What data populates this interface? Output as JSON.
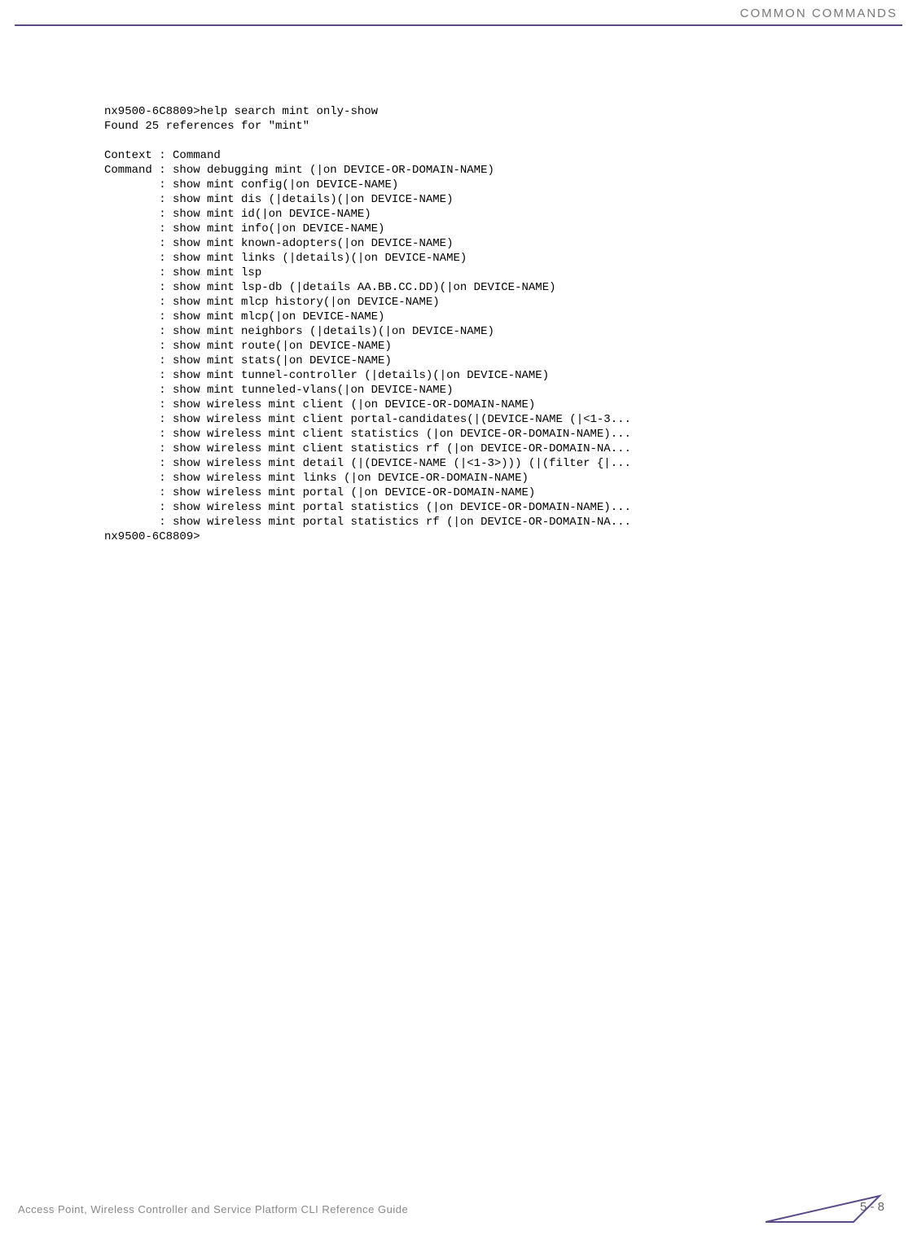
{
  "header": {
    "section_title": "COMMON COMMANDS"
  },
  "terminal": {
    "line01": "nx9500-6C8809>help search mint only-show",
    "line02": "Found 25 references for \"mint\"",
    "line03": "",
    "line04": "Context : Command",
    "line05": "Command : show debugging mint (|on DEVICE-OR-DOMAIN-NAME)",
    "line06": "        : show mint config(|on DEVICE-NAME)",
    "line07": "        : show mint dis (|details)(|on DEVICE-NAME)",
    "line08": "        : show mint id(|on DEVICE-NAME)",
    "line09": "        : show mint info(|on DEVICE-NAME)",
    "line10": "        : show mint known-adopters(|on DEVICE-NAME)",
    "line11": "        : show mint links (|details)(|on DEVICE-NAME)",
    "line12": "        : show mint lsp",
    "line13": "        : show mint lsp-db (|details AA.BB.CC.DD)(|on DEVICE-NAME)",
    "line14": "        : show mint mlcp history(|on DEVICE-NAME)",
    "line15": "        : show mint mlcp(|on DEVICE-NAME)",
    "line16": "        : show mint neighbors (|details)(|on DEVICE-NAME)",
    "line17": "        : show mint route(|on DEVICE-NAME)",
    "line18": "        : show mint stats(|on DEVICE-NAME)",
    "line19": "        : show mint tunnel-controller (|details)(|on DEVICE-NAME)",
    "line20": "        : show mint tunneled-vlans(|on DEVICE-NAME)",
    "line21": "        : show wireless mint client (|on DEVICE-OR-DOMAIN-NAME)",
    "line22": "        : show wireless mint client portal-candidates(|(DEVICE-NAME (|<1-3...",
    "line23": "        : show wireless mint client statistics (|on DEVICE-OR-DOMAIN-NAME)...",
    "line24": "        : show wireless mint client statistics rf (|on DEVICE-OR-DOMAIN-NA...",
    "line25": "        : show wireless mint detail (|(DEVICE-NAME (|<1-3>))) (|(filter {|...",
    "line26": "        : show wireless mint links (|on DEVICE-OR-DOMAIN-NAME)",
    "line27": "        : show wireless mint portal (|on DEVICE-OR-DOMAIN-NAME)",
    "line28": "        : show wireless mint portal statistics (|on DEVICE-OR-DOMAIN-NAME)...",
    "line29": "        : show wireless mint portal statistics rf (|on DEVICE-OR-DOMAIN-NA...",
    "line30": "nx9500-6C8809>"
  },
  "footer": {
    "guide_title": "Access Point, Wireless Controller and Service Platform CLI Reference Guide",
    "page_number": "5 - 8"
  }
}
